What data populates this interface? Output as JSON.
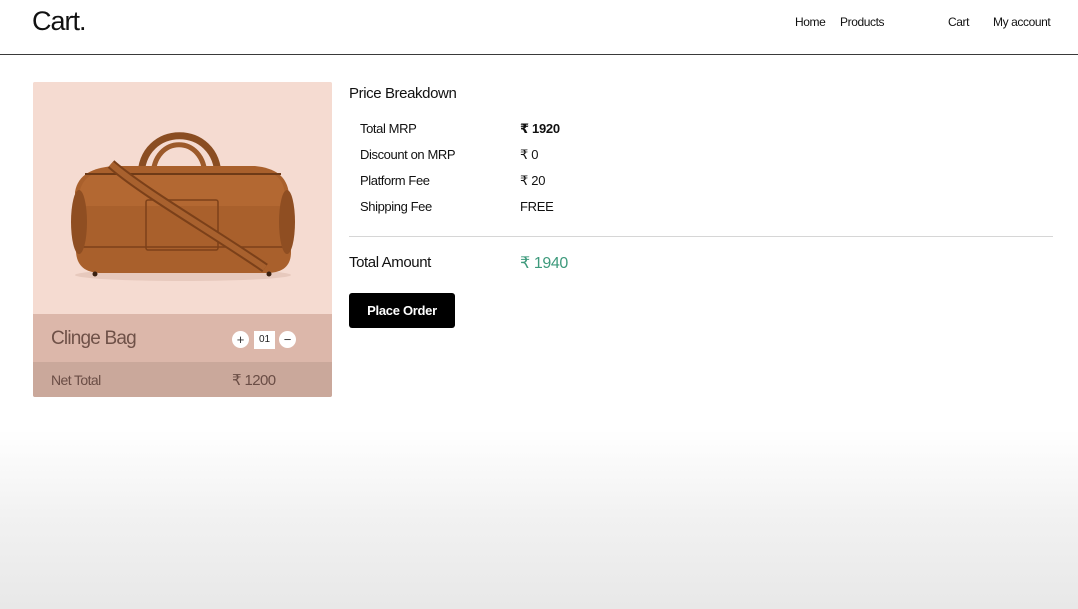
{
  "header": {
    "logo": "Cart.",
    "nav": {
      "home": "Home",
      "products": "Products",
      "cart": "Cart",
      "account": "My account"
    }
  },
  "product": {
    "name": "Clinge Bag",
    "quantity": "01",
    "increment_symbol": "+",
    "decrement_symbol": "−",
    "net_total_label": "Net Total",
    "net_total_value": "₹ 1200",
    "image": "brown-leather-duffel-bag"
  },
  "breakdown": {
    "title": "Price Breakdown",
    "rows": [
      {
        "label": "Total MRP",
        "value": "₹ 1920"
      },
      {
        "label": "Discount on MRP",
        "value": "₹ 0"
      },
      {
        "label": "Platform Fee",
        "value": "₹ 20"
      },
      {
        "label": "Shipping Fee",
        "value": "FREE"
      }
    ],
    "total_label": "Total Amount",
    "total_value": "₹ 1940"
  },
  "actions": {
    "place_order": "Place Order"
  },
  "colors": {
    "card_background": "#f5dbd1",
    "card_name_row": "#dcb7aa",
    "card_total_row": "#caa89b",
    "total_accent": "#3e9a7c",
    "button": "#000000"
  }
}
